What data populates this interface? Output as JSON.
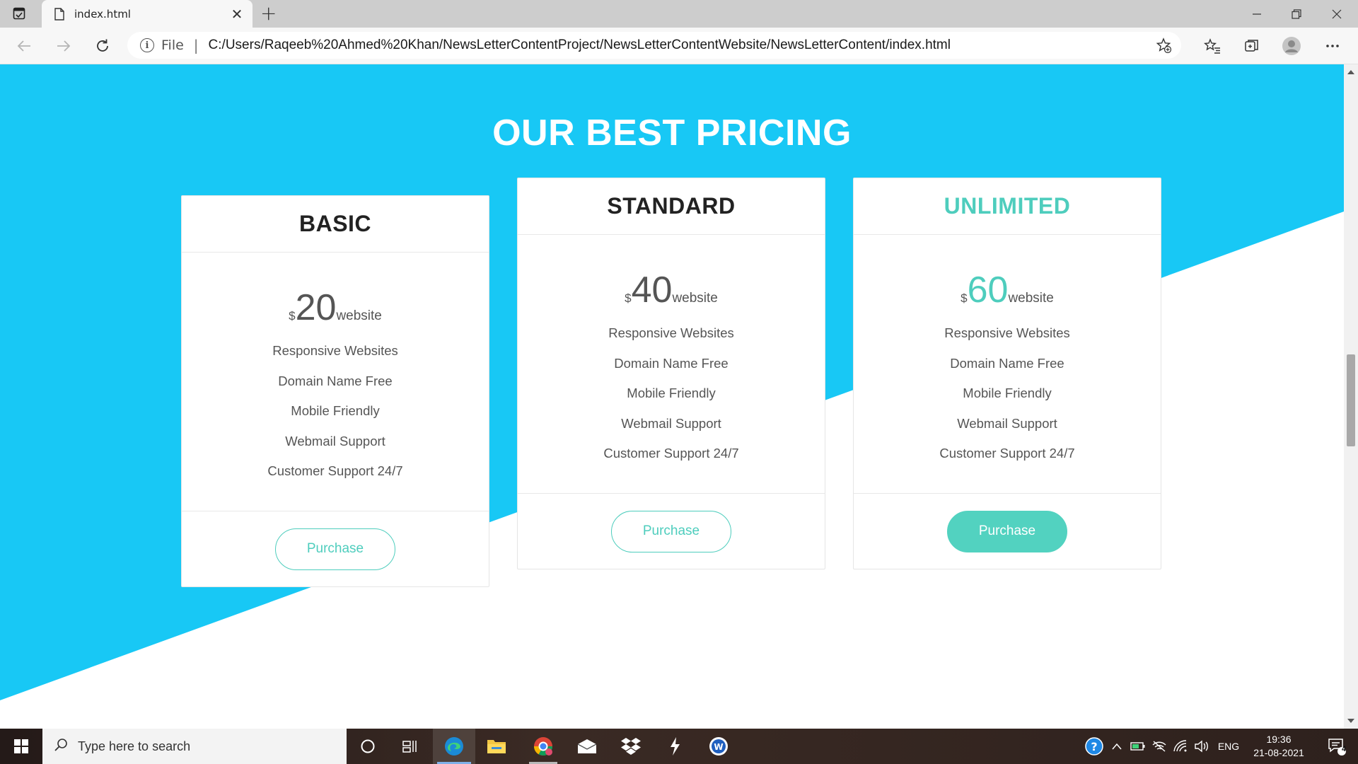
{
  "browser": {
    "tab_title": "index.html",
    "address_prefix": "File",
    "address_separator": "|",
    "url": "C:/Users/Raqeeb%20Ahmed%20Khan/NewsLetterContentProject/NewsLetterContentWebsite/NewsLetterContent/index.html"
  },
  "colors": {
    "hero_blue": "#18c8f5",
    "accent_teal": "#4ecdbd",
    "text_dark": "#222222",
    "text_muted": "#555555"
  },
  "pricing": {
    "title": "OUR BEST PRICING",
    "plans": [
      {
        "name": "BASIC",
        "currency": "$",
        "price": "20",
        "unit": "website",
        "features": [
          "Responsive Websites",
          "Domain Name Free",
          "Mobile Friendly",
          "Webmail Support",
          "Customer Support 24/7"
        ],
        "button": "Purchase"
      },
      {
        "name": "STANDARD",
        "currency": "$",
        "price": "40",
        "unit": "website",
        "features": [
          "Responsive Websites",
          "Domain Name Free",
          "Mobile Friendly",
          "Webmail Support",
          "Customer Support 24/7"
        ],
        "button": "Purchase"
      },
      {
        "name": "UNLIMITED",
        "currency": "$",
        "price": "60",
        "unit": "website",
        "features": [
          "Responsive Websites",
          "Domain Name Free",
          "Mobile Friendly",
          "Webmail Support",
          "Customer Support 24/7"
        ],
        "button": "Purchase"
      }
    ]
  },
  "taskbar": {
    "search_placeholder": "Type here to search",
    "language": "ENG",
    "time": "19:36",
    "date": "21-08-2021",
    "notification_count": "4",
    "apps": [
      "task-view",
      "edge",
      "file-explorer",
      "chrome",
      "mail",
      "dropbox",
      "vscode",
      "word"
    ]
  }
}
